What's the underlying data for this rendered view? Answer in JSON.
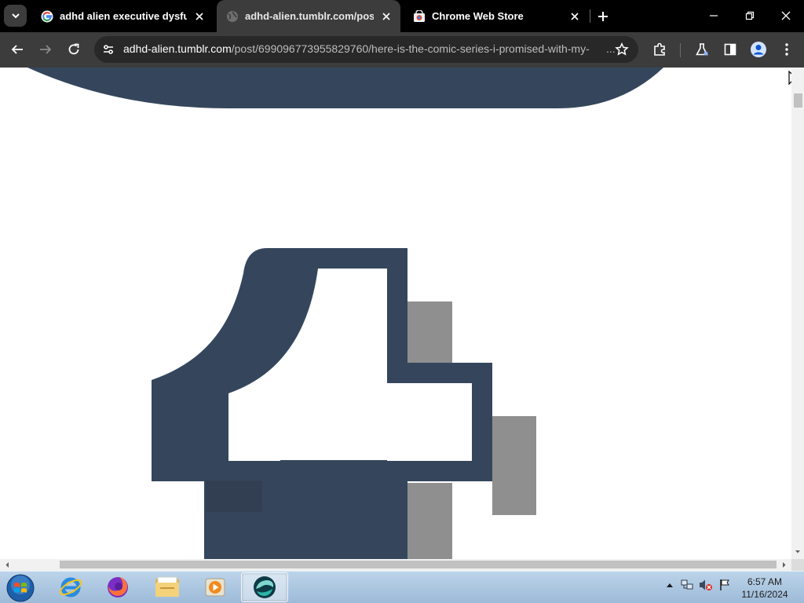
{
  "browser": {
    "tabs": [
      {
        "title": "adhd alien executive dysfuncti",
        "favicon": "google-icon",
        "active": false
      },
      {
        "title": "adhd-alien.tumblr.com/post/6",
        "favicon": "globe-icon",
        "active": true
      },
      {
        "title": "Chrome Web Store",
        "favicon": "web-store-icon",
        "active": false
      }
    ],
    "url_host": "adhd-alien.tumblr.com",
    "url_path": "/post/699096773955829760/here-is-the-comic-series-i-promised-with-my-",
    "url_tail": "..."
  },
  "page": {
    "logo": "tumblr-t-logo",
    "colors": {
      "logo": "#35465c",
      "shadow": "#8f8f8f"
    }
  },
  "taskbar": {
    "apps": [
      "internet-explorer-icon",
      "firefox-icon",
      "file-explorer-icon",
      "media-player-icon",
      "chrome-app-icon"
    ],
    "time": "6:57 AM",
    "date": "11/16/2024"
  }
}
